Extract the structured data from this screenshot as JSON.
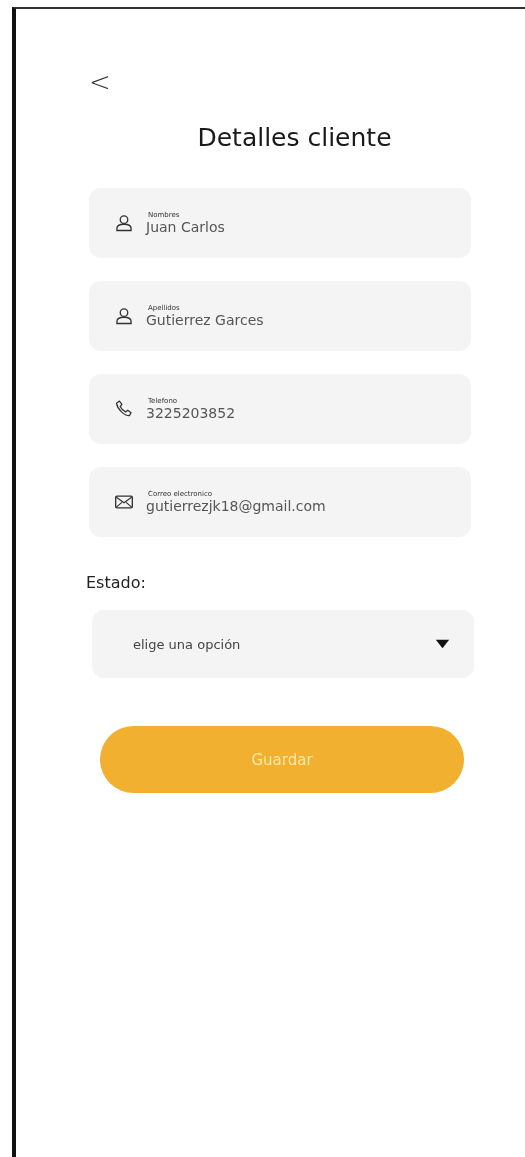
{
  "back_button": {
    "label": "<"
  },
  "title": "Detalles cliente",
  "fields": [
    {
      "kind": "person",
      "label": "Nombres",
      "value": "Juan Carlos"
    },
    {
      "kind": "person",
      "label": "Apellidos",
      "value": "Gutierrez Garces"
    },
    {
      "kind": "phone",
      "label": "Telefono",
      "value": "3225203852"
    },
    {
      "kind": "email",
      "label": "Correo electronico",
      "value": "gutierrezjk18@gmail.com"
    }
  ],
  "status": {
    "label": "Estado:",
    "placeholder": "elige una opción"
  },
  "save_button": {
    "label": "Guardar"
  }
}
